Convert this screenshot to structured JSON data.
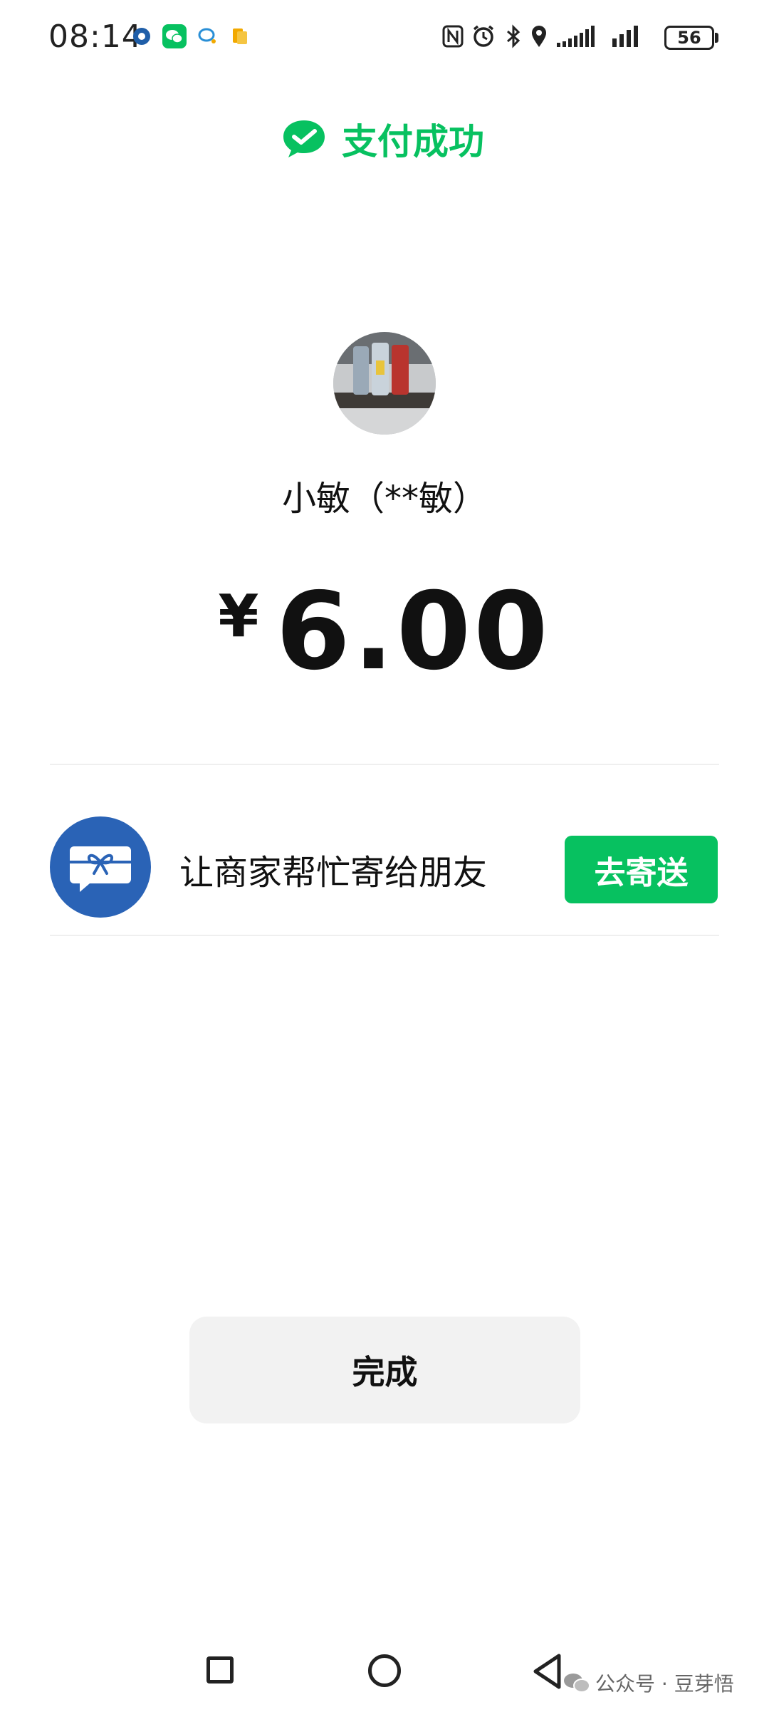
{
  "status_bar": {
    "time": "08:14",
    "battery": "56",
    "icons": [
      "china-mobile-icon",
      "wechat-icon",
      "chat-bubble-icon",
      "docs-icon",
      "nfc-icon",
      "alarm-icon",
      "bluetooth-icon",
      "location-icon",
      "signal-icon",
      "signal-icon"
    ]
  },
  "header": {
    "title": "支付成功",
    "icon": "check-bubble-icon"
  },
  "payee": {
    "name": "小敏（**敏）"
  },
  "amount": {
    "currency": "¥",
    "value": "6.00"
  },
  "gift": {
    "text": "让商家帮忙寄给朋友",
    "button_label": "去寄送",
    "icon": "gift-card-icon"
  },
  "done_button_label": "完成",
  "nav": {
    "icons": [
      "recent-apps-icon",
      "home-icon",
      "back-icon"
    ]
  },
  "watermark": {
    "text": "公众号 · 豆芽悟"
  },
  "colors": {
    "accent": "#07c160",
    "gift_icon_bg": "#2a63b6",
    "done_button_bg": "#f2f2f2"
  }
}
